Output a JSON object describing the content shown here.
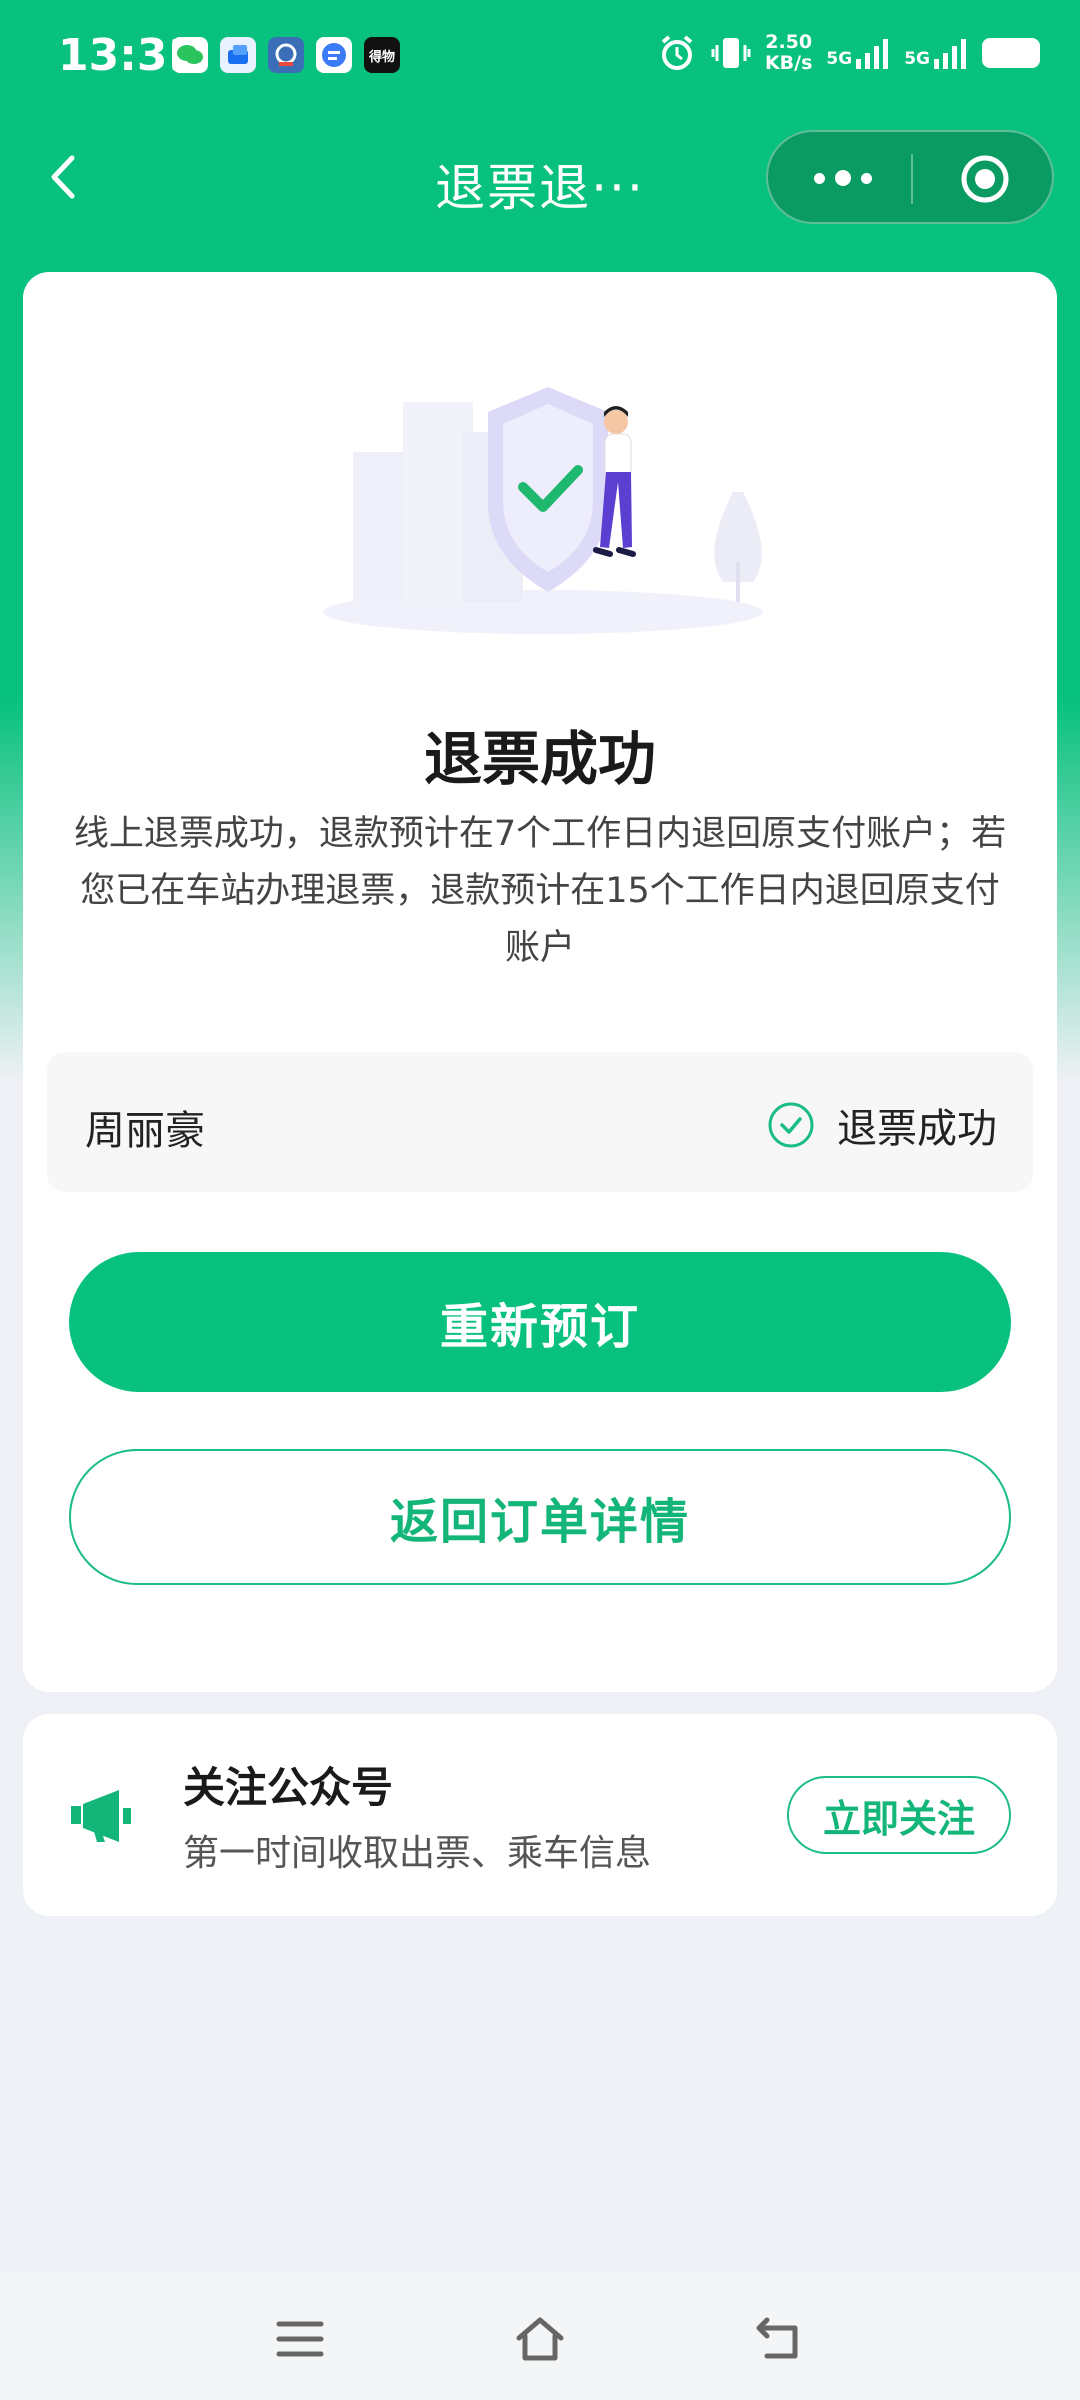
{
  "status_bar": {
    "time": "13:31",
    "net_speed_value": "2.50",
    "net_speed_unit": "KB/s",
    "signal1": "5G",
    "signal2": "5G",
    "app_icons": [
      "wechat-icon",
      "app-blue-icon",
      "app-railway-icon",
      "app-chat-icon",
      "app-news-icon"
    ],
    "news_app_text": "得物"
  },
  "nav": {
    "title": "退票退···"
  },
  "result": {
    "title": "退票成功",
    "description": "线上退票成功，退款预计在7个工作日内退回原支付账户；若您已在车站办理退票，退款预计在15个工作日内退回原支付账户"
  },
  "passenger": {
    "name": "周丽豪",
    "status": "退票成功"
  },
  "buttons": {
    "rebook": "重新预订",
    "back_to_order": "返回订单详情"
  },
  "follow": {
    "title": "关注公众号",
    "subtitle": "第一时间收取出票、乘车信息",
    "button": "立即关注"
  },
  "colors": {
    "brand_green": "#08c17e",
    "background": "#eef1f6"
  }
}
